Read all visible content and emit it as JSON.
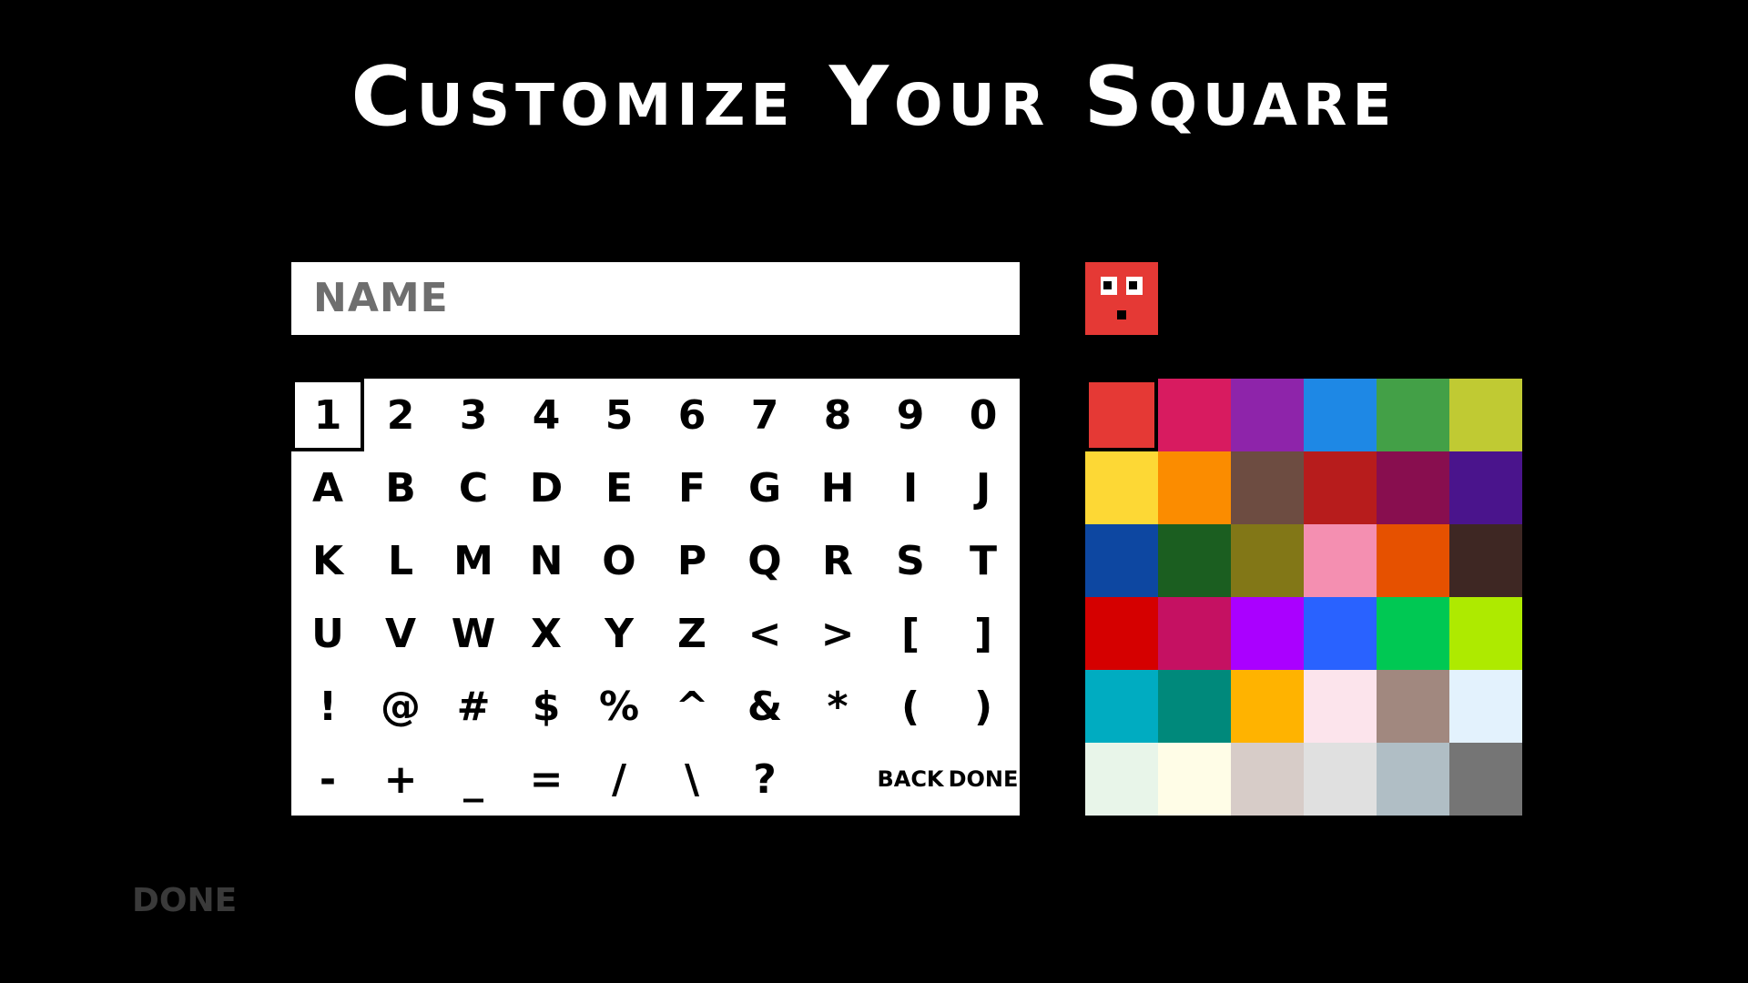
{
  "title": "Customize Your Square",
  "name_field": {
    "placeholder": "NAME",
    "value": ""
  },
  "avatar": {
    "color": "#e53935",
    "face": "square-face-icon"
  },
  "keyboard": {
    "selected_index": 0,
    "rows": [
      [
        "1",
        "2",
        "3",
        "4",
        "5",
        "6",
        "7",
        "8",
        "9",
        "0"
      ],
      [
        "A",
        "B",
        "C",
        "D",
        "E",
        "F",
        "G",
        "H",
        "I",
        "J"
      ],
      [
        "K",
        "L",
        "M",
        "N",
        "O",
        "P",
        "Q",
        "R",
        "S",
        "T"
      ],
      [
        "U",
        "V",
        "W",
        "X",
        "Y",
        "Z",
        "<",
        ">",
        "[",
        "]"
      ],
      [
        "!",
        "@",
        "#",
        "$",
        "%",
        "^",
        "&",
        "*",
        "(",
        ")"
      ],
      [
        "-",
        "+",
        "_",
        "=",
        "/",
        "\\",
        "?",
        "",
        "BACK",
        "DONE"
      ]
    ]
  },
  "palette": {
    "selected_index": 0,
    "colors": [
      "#e53935",
      "#d81b60",
      "#8e24aa",
      "#1e88e5",
      "#43a047",
      "#c0ca33",
      "#fdd835",
      "#fb8c00",
      "#6d4c41",
      "#b71c1c",
      "#880e4f",
      "#4a148c",
      "#0d47a1",
      "#1b5e20",
      "#827717",
      "#f48fb1",
      "#e65100",
      "#3e2723",
      "#d50000",
      "#c51162",
      "#aa00ff",
      "#2962ff",
      "#00c853",
      "#aeea00",
      "#00acc1",
      "#00897b",
      "#ffb300",
      "#fce4ec",
      "#a1887f",
      "#e3f2fd",
      "#e8f5e9",
      "#fffde7",
      "#d7ccc8",
      "#e0e0e0",
      "#b0bec5",
      "#757575"
    ]
  },
  "footer": {
    "done_label": "DONE"
  }
}
